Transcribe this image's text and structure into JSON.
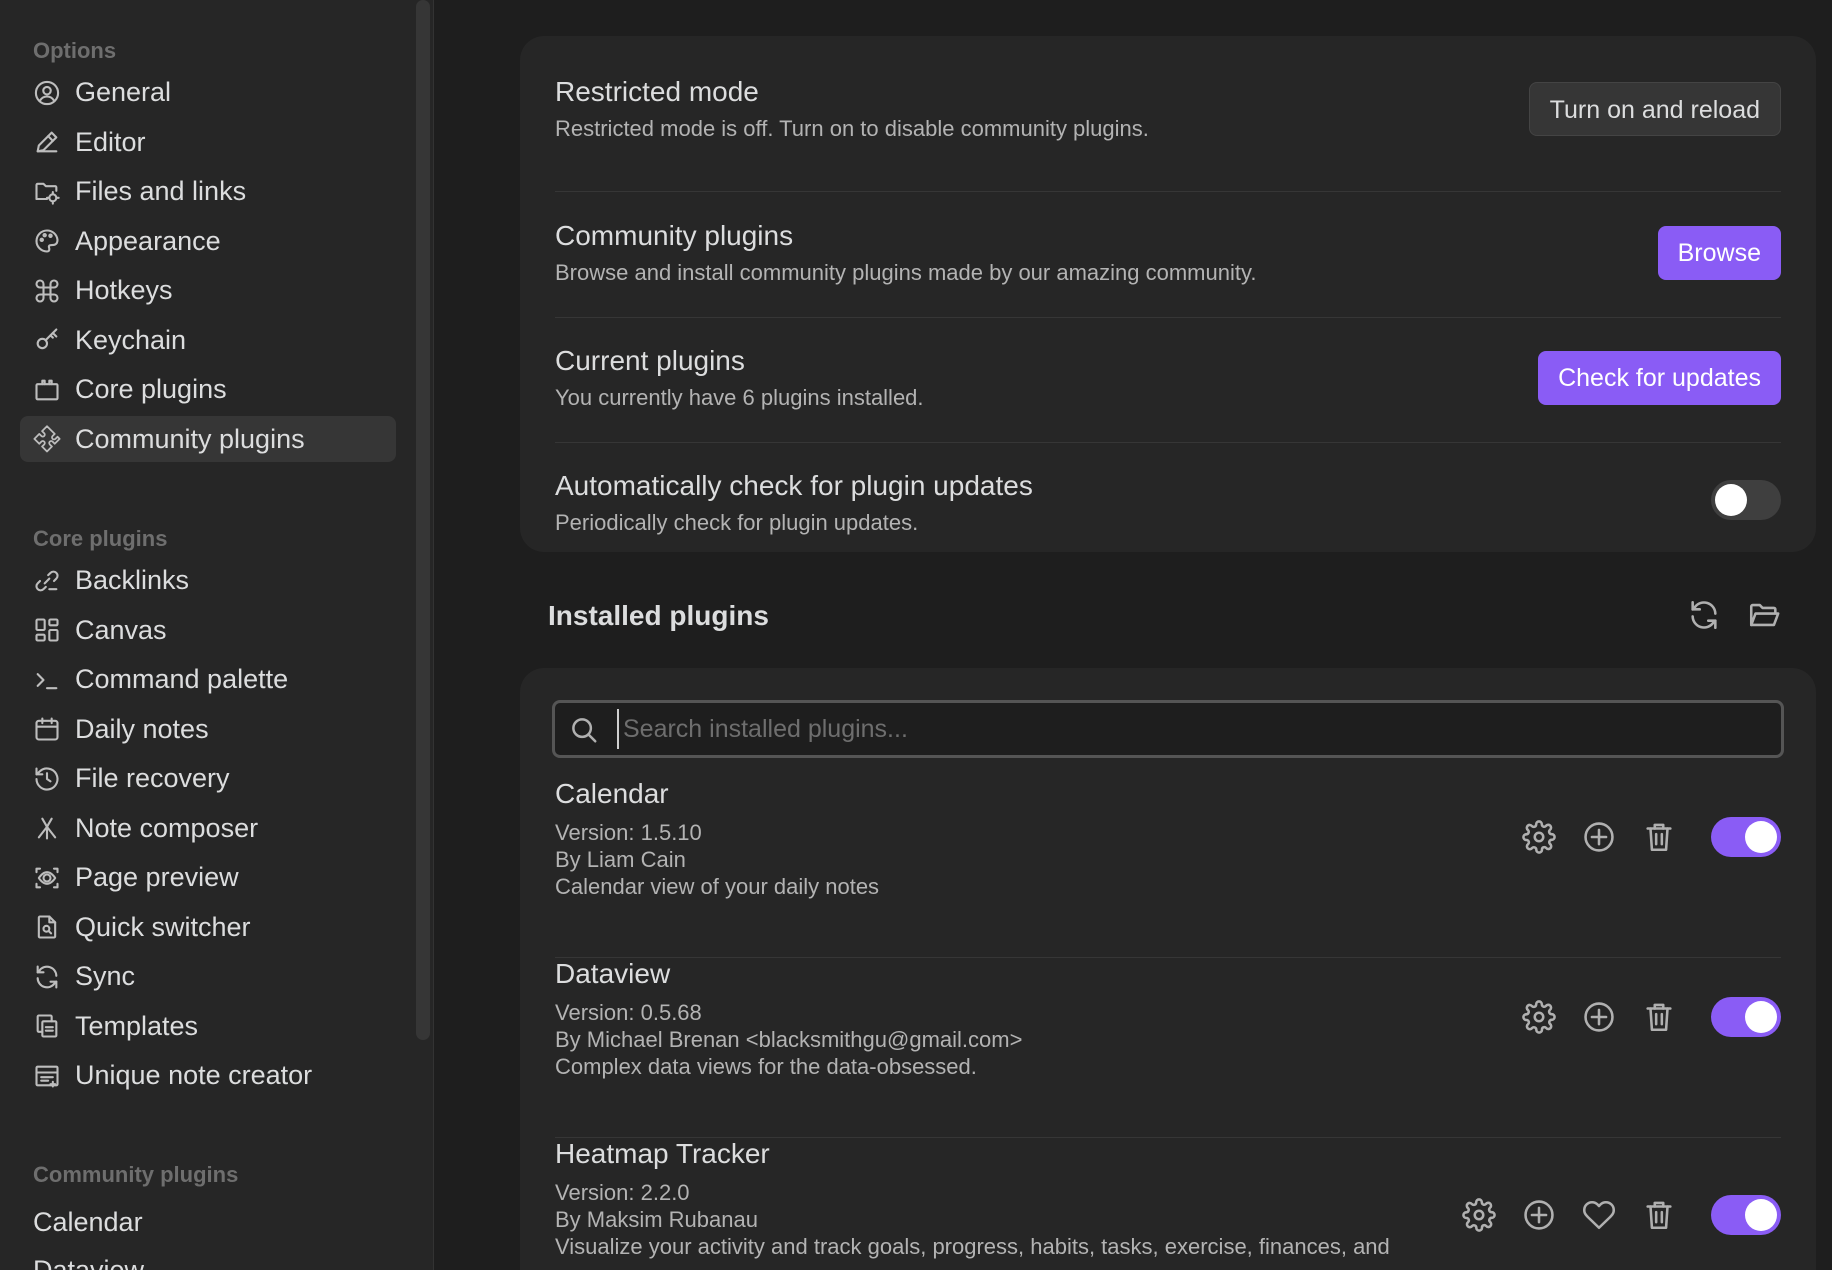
{
  "sidebar": {
    "options_heading": "Options",
    "options": [
      {
        "label": "General",
        "icon": "general-icon"
      },
      {
        "label": "Editor",
        "icon": "editor-icon"
      },
      {
        "label": "Files and links",
        "icon": "files-and-links-icon"
      },
      {
        "label": "Appearance",
        "icon": "appearance-icon"
      },
      {
        "label": "Hotkeys",
        "icon": "hotkeys-icon"
      },
      {
        "label": "Keychain",
        "icon": "keychain-icon"
      },
      {
        "label": "Core plugins",
        "icon": "core-plugins-icon"
      },
      {
        "label": "Community plugins",
        "icon": "community-plugins-icon"
      }
    ],
    "core_heading": "Core plugins",
    "core": [
      {
        "label": "Backlinks",
        "icon": "backlinks-icon"
      },
      {
        "label": "Canvas",
        "icon": "canvas-icon"
      },
      {
        "label": "Command palette",
        "icon": "command-palette-icon"
      },
      {
        "label": "Daily notes",
        "icon": "daily-notes-icon"
      },
      {
        "label": "File recovery",
        "icon": "file-recovery-icon"
      },
      {
        "label": "Note composer",
        "icon": "note-composer-icon"
      },
      {
        "label": "Page preview",
        "icon": "page-preview-icon"
      },
      {
        "label": "Quick switcher",
        "icon": "quick-switcher-icon"
      },
      {
        "label": "Sync",
        "icon": "sync-icon"
      },
      {
        "label": "Templates",
        "icon": "templates-icon"
      },
      {
        "label": "Unique note creator",
        "icon": "unique-note-creator-icon"
      }
    ],
    "community_heading": "Community plugins",
    "community": [
      {
        "label": "Calendar"
      },
      {
        "label": "Dataview"
      }
    ]
  },
  "settings": {
    "restricted": {
      "name": "Restricted mode",
      "desc": "Restricted mode is off. Turn on to disable community plugins.",
      "button": "Turn on and reload"
    },
    "community": {
      "name": "Community plugins",
      "desc": "Browse and install community plugins made by our amazing community.",
      "button": "Browse"
    },
    "current": {
      "name": "Current plugins",
      "desc": "You currently have 6 plugins installed.",
      "button": "Check for updates"
    },
    "auto_check": {
      "name": "Automatically check for plugin updates",
      "desc": "Periodically check for plugin updates.",
      "enabled": false
    }
  },
  "installed": {
    "title": "Installed plugins",
    "search_placeholder": "Search installed plugins...",
    "plugins": [
      {
        "name": "Calendar",
        "version": "Version: 1.5.10",
        "author": "By Liam Cain",
        "desc": "Calendar view of your daily notes",
        "enabled": true,
        "has_donate": false
      },
      {
        "name": "Dataview",
        "version": "Version: 0.5.68",
        "author": "By Michael Brenan <blacksmithgu@gmail.com>",
        "desc": "Complex data views for the data-obsessed.",
        "enabled": true,
        "has_donate": false
      },
      {
        "name": "Heatmap Tracker",
        "version": "Version: 2.2.0",
        "author": "By Maksim Rubanau",
        "desc": "Visualize your activity and track goals, progress, habits, tasks, exercise, finances, and",
        "enabled": true,
        "has_donate": true
      }
    ]
  },
  "colors": {
    "accent": "#8a5cf5",
    "background": "#1e1e1e",
    "panel": "#262626"
  }
}
